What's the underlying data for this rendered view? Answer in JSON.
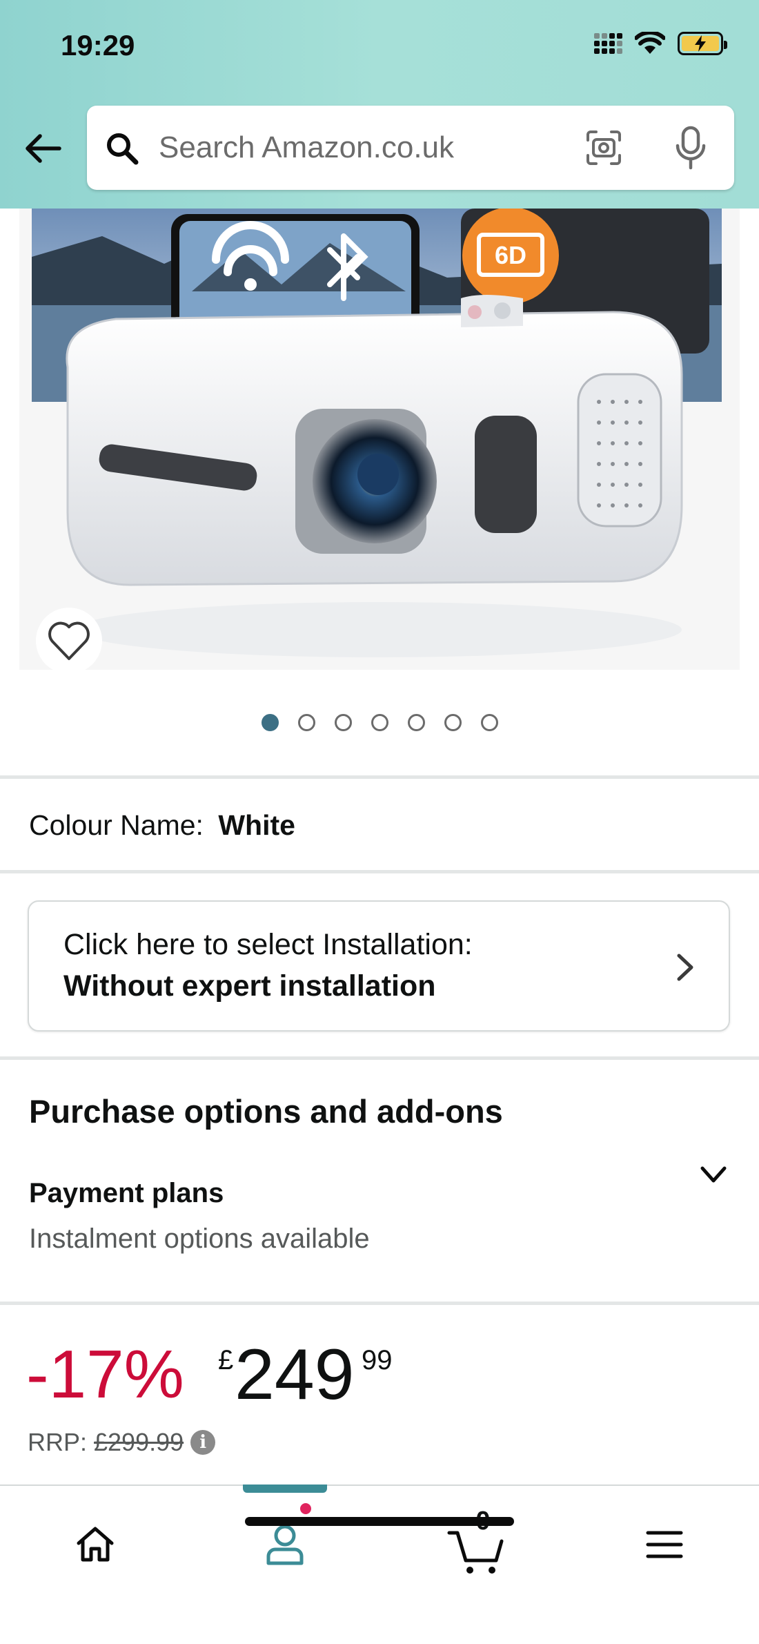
{
  "status_bar": {
    "time": "19:29"
  },
  "search": {
    "placeholder": "Search Amazon.co.uk"
  },
  "gallery": {
    "image_count": 7,
    "active_index": 0
  },
  "colour": {
    "label": "Colour Name:",
    "value": "White"
  },
  "installation": {
    "line1": "Click here to select Installation:",
    "line2": "Without expert installation"
  },
  "purchase_options": {
    "title": "Purchase options and add-ons",
    "payment_plans_title": "Payment plans",
    "payment_plans_sub": "Instalment options available"
  },
  "price": {
    "discount": "-17%",
    "currency": "£",
    "whole": "249",
    "fraction": "99",
    "rrp_label": "RRP:",
    "rrp_value": "£299.99"
  },
  "bottom_nav": {
    "cart_count": "0"
  },
  "colors": {
    "accent": "#3c6f84",
    "discount": "#cc0c39",
    "header_bg": "#a6e0d8",
    "notification": "#e0245e"
  }
}
